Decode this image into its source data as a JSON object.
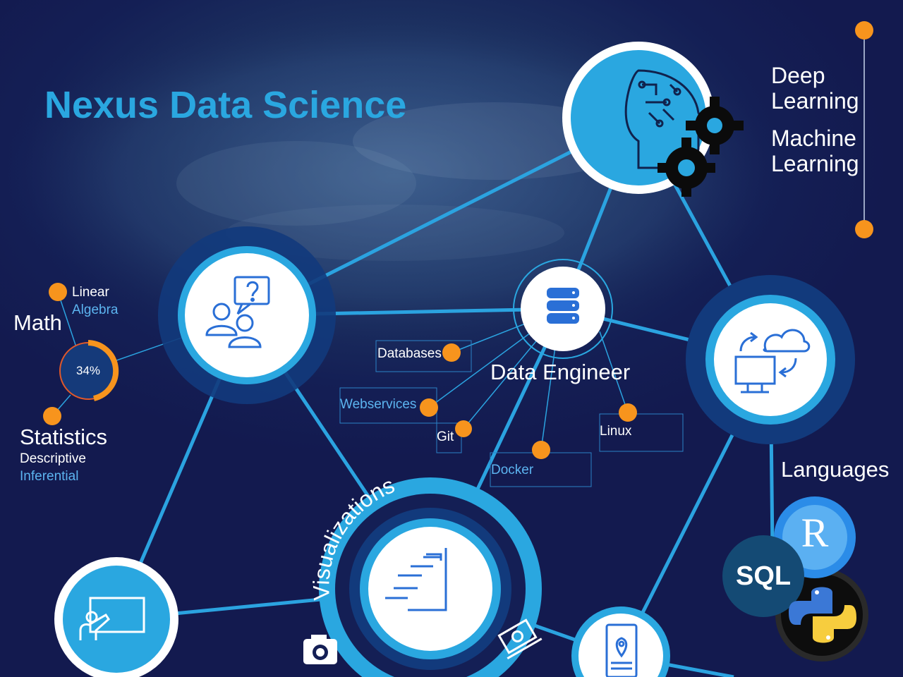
{
  "title": "Nexus Data Science",
  "ai": {
    "line1": "Deep",
    "line2": "Learning",
    "line3": "Machine",
    "line4": "Learning"
  },
  "math": {
    "title": "Math",
    "sub1": "Linear",
    "sub2": "Algebra",
    "percent": "34%",
    "percent_value": 0.34
  },
  "statistics": {
    "title": "Statistics",
    "sub1": "Descriptive",
    "sub2": "Inferential"
  },
  "data_engineer": {
    "title": "Data Engineer",
    "tools": [
      "Databases",
      "Webservices",
      "Git",
      "Docker",
      "Linux"
    ]
  },
  "languages": {
    "title": "Languages",
    "items": [
      "R",
      "SQL",
      "Python"
    ]
  },
  "visualizations": {
    "title": "Visualizations"
  },
  "colors": {
    "accent": "#2aa7e0",
    "orange": "#f7941d",
    "navy": "#141f55",
    "ring": "#0f3d80"
  }
}
